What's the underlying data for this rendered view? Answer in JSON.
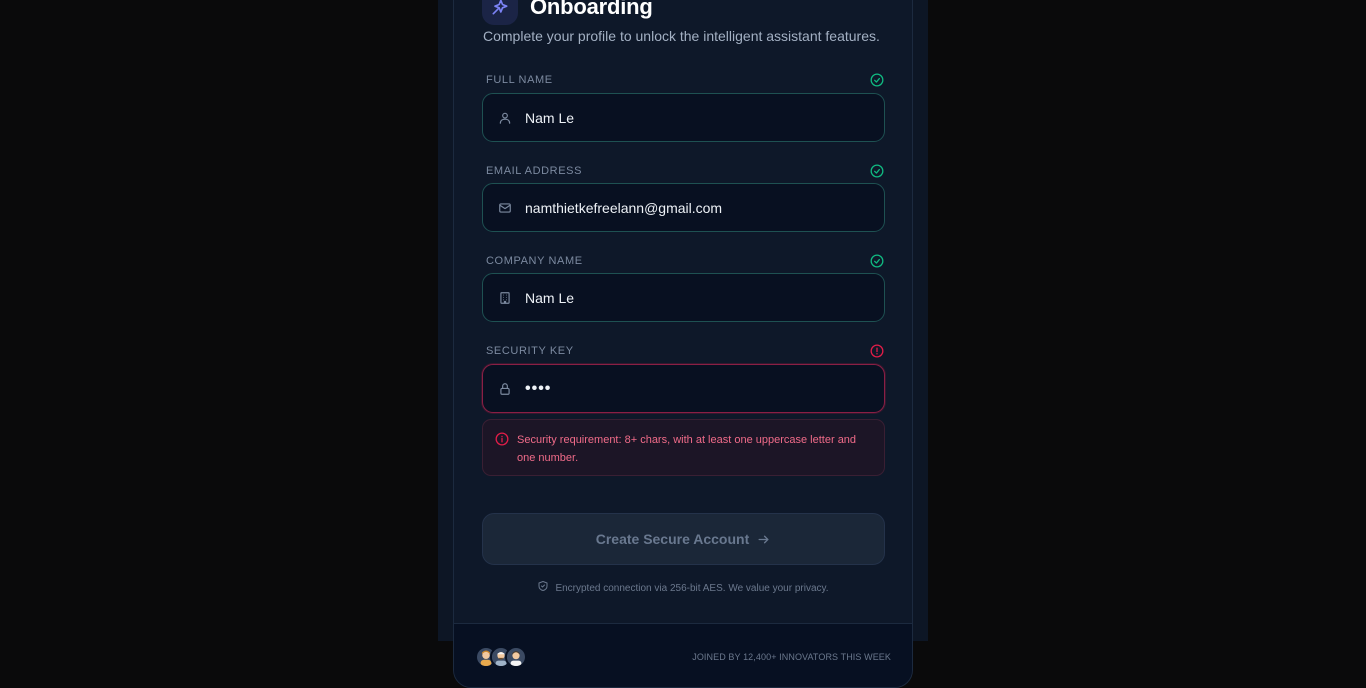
{
  "header": {
    "title": "Onboarding",
    "subtitle": "Complete your profile to unlock the intelligent assistant features."
  },
  "fields": [
    {
      "label": "FULL NAME",
      "value": "Nam Le",
      "icon": "user-icon",
      "status": "valid"
    },
    {
      "label": "EMAIL ADDRESS",
      "value": "namthietkefreelann@gmail.com",
      "icon": "mail-icon",
      "status": "valid"
    },
    {
      "label": "COMPANY NAME",
      "value": "Nam Le",
      "icon": "building-icon",
      "status": "valid"
    },
    {
      "label": "SECURITY KEY",
      "value": "••••",
      "icon": "lock-icon",
      "status": "error"
    }
  ],
  "error": {
    "message": "Security requirement: 8+ chars, with at least one uppercase letter and one number."
  },
  "cta": {
    "label": "Create Secure Account",
    "icon": "arrow-right-icon"
  },
  "privacy": {
    "text": "Encrypted connection via 256-bit AES. We value your privacy.",
    "icon": "shield-icon"
  },
  "footer": {
    "text": "JOINED BY 12,400+ INNOVATORS THIS WEEK"
  },
  "colors": {
    "valid": "#10b981",
    "error": "#e11d48",
    "accent": "#6366f1"
  }
}
